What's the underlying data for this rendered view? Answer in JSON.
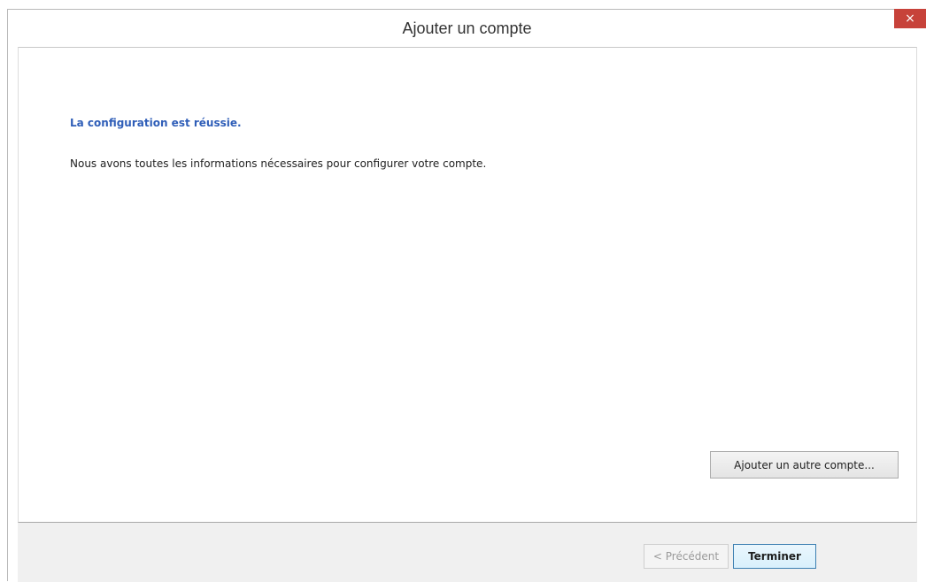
{
  "window": {
    "title": "Ajouter un compte",
    "close_icon": "×"
  },
  "content": {
    "success_heading": "La configuration est réussie.",
    "success_message": "Nous avons toutes les informations nécessaires pour configurer votre compte.",
    "add_another_label": "Ajouter un autre compte..."
  },
  "footer": {
    "prev_label": "< Précédent",
    "finish_label": "Terminer"
  },
  "colors": {
    "accent_heading": "#2f5eb8",
    "close_button": "#c7423a",
    "default_button_border": "#3c7fb1"
  }
}
